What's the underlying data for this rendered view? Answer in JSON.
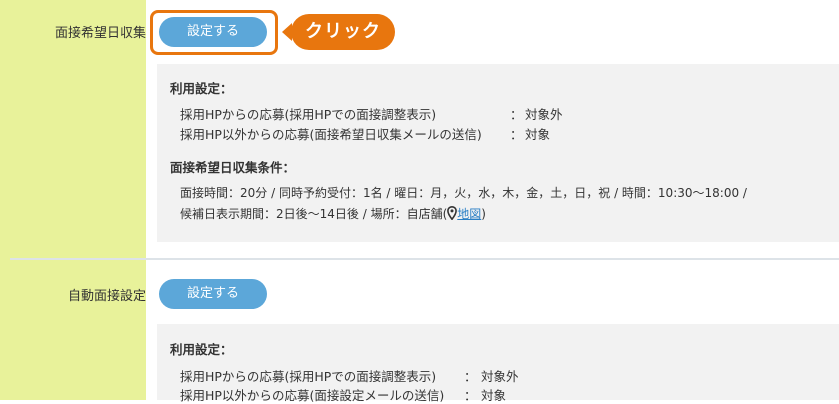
{
  "sections": [
    {
      "label": "面接希望日収集",
      "button": "設定する",
      "callout": "クリック",
      "usage_heading": "利用設定：",
      "usage_rows": [
        {
          "label": "採用HPからの応募(採用HPでの面接調整表示)",
          "sep": "：",
          "value": "対象外"
        },
        {
          "label": "採用HP以外からの応募(面接希望日収集メールの送信)",
          "sep": "：",
          "value": "対象"
        }
      ],
      "conditions_heading": "面接希望日収集条件：",
      "conditions_line1": "面接時間：20分 / 同時予約受付：1名 / 曜日：月，火，水，木，金，土，日，祝 / 時間：10:30〜18:00 /",
      "conditions_line2_prefix": "候補日表示期間：2日後〜14日後 / 場所：自店舗(",
      "map_link": "地図",
      "conditions_line2_suffix": ")"
    },
    {
      "label": "自動面接設定",
      "button": "設定する",
      "usage_heading": "利用設定：",
      "usage_rows": [
        {
          "label": "採用HPからの応募(採用HPでの面接調整表示)",
          "sep": "：",
          "value": "対象外"
        },
        {
          "label": "採用HP以外からの応募(面接設定メールの送信)",
          "sep": "：",
          "value": "対象"
        }
      ]
    }
  ],
  "colors": {
    "left_column": "#e8f29a",
    "button": "#5ca7d9",
    "highlight": "#e8760e",
    "panel": "#f2f2f2",
    "link": "#2a7fc5"
  },
  "icons": [
    "map-pin-icon"
  ]
}
